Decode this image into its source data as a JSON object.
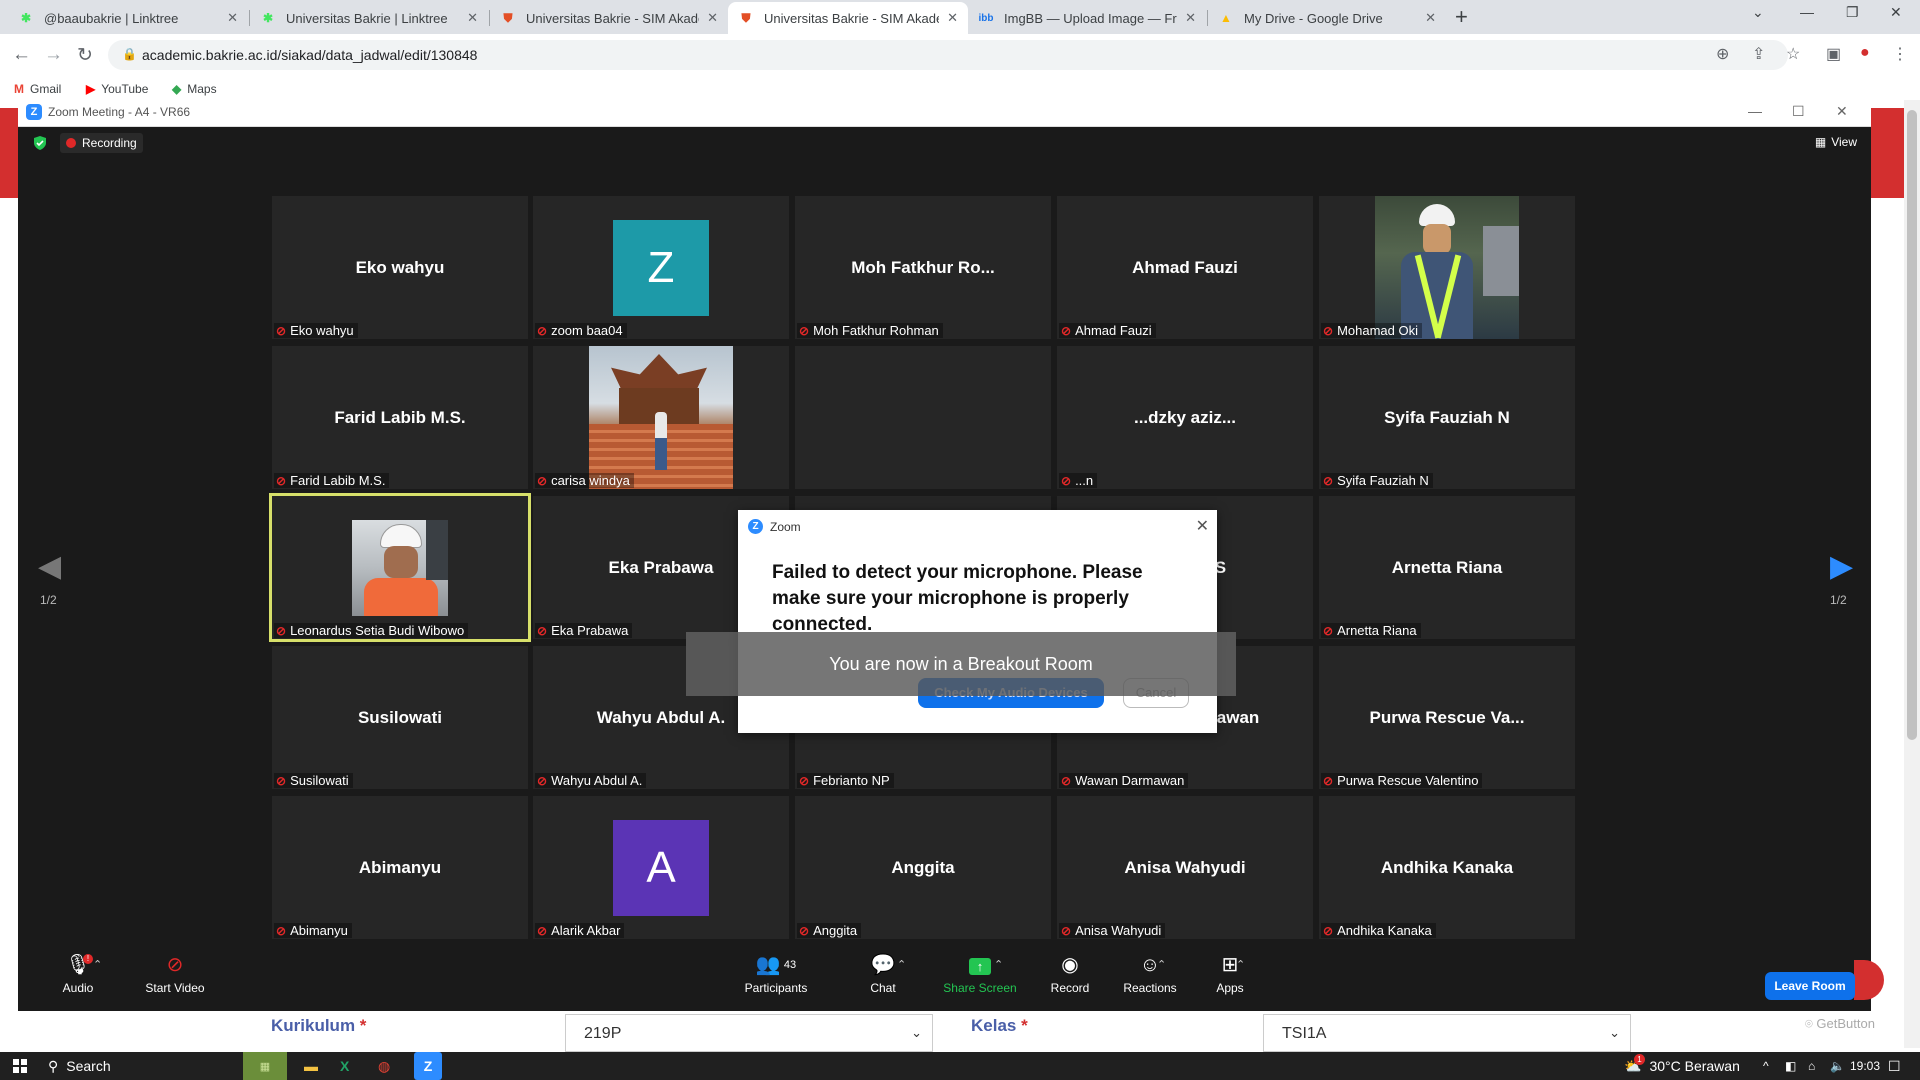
{
  "browser": {
    "tabs": [
      {
        "title": "@baaubakrie | Linktree",
        "icon": "linktree-icon",
        "active": false
      },
      {
        "title": "Universitas Bakrie | Linktree",
        "icon": "linktree-icon",
        "active": false
      },
      {
        "title": "Universitas Bakrie - SIM Akadem",
        "icon": "html5-icon",
        "active": false
      },
      {
        "title": "Universitas Bakrie - SIM Akadem",
        "icon": "html5-icon",
        "active": true
      },
      {
        "title": "ImgBB — Upload Image — Free",
        "icon": "imgbb-icon",
        "active": false
      },
      {
        "title": "My Drive - Google Drive",
        "icon": "drive-icon",
        "active": false
      }
    ],
    "url": "academic.bakrie.ac.id/siakad/data_jadwal/edit/130848",
    "bookmarks": [
      {
        "label": "Gmail"
      },
      {
        "label": "YouTube"
      },
      {
        "label": "Maps"
      }
    ]
  },
  "zoom": {
    "window_title": "Zoom Meeting - A4 - VR66",
    "recording_label": "Recording",
    "view_label": "View",
    "page_indicator_left": "1/2",
    "page_indicator_right": "1/2",
    "tiles": [
      {
        "big": "Eko wahyu",
        "label": "Eko wahyu"
      },
      {
        "big": "",
        "label": "zoom baa04",
        "avatar": "Z",
        "avatar_color": "#1d9aa8"
      },
      {
        "big": "Moh  Fatkhur  Ro...",
        "label": "Moh Fatkhur Rohman"
      },
      {
        "big": "Ahmad Fauzi",
        "label": "Ahmad Fauzi"
      },
      {
        "big": "",
        "label": "Mohamad Oki",
        "photo": "worker"
      },
      {
        "big": "Farid Labib M.S.",
        "label": "Farid Labib M.S."
      },
      {
        "big": "",
        "label": "carisa windya",
        "photo": "pavilion"
      },
      {
        "big": "",
        "label": ""
      },
      {
        "big": "...dzky aziz...",
        "label": "...n"
      },
      {
        "big": "Syifa Fauziah N",
        "label": "Syifa Fauziah N"
      },
      {
        "big": "",
        "label": "Leonardus Setia Budi Wibowo",
        "photo": "helmet",
        "active": true
      },
      {
        "big": "Eka Prabawa",
        "label": "Eka Prabawa"
      },
      {
        "big": "",
        "label": ""
      },
      {
        "big": "...ctus B S",
        "label": ""
      },
      {
        "big": "Arnetta Riana",
        "label": "Arnetta Riana"
      },
      {
        "big": "Susilowati",
        "label": "Susilowati"
      },
      {
        "big": "Wahyu Abdul A.",
        "label": "Wahyu Abdul A."
      },
      {
        "big": "Febrianto NP",
        "label": "Febrianto NP"
      },
      {
        "big": "Wawan Darmawan",
        "label": "Wawan Darmawan"
      },
      {
        "big": "Purwa  Rescue  Va...",
        "label": "Purwa Rescue Valentino"
      },
      {
        "big": "Abimanyu",
        "label": "Abimanyu"
      },
      {
        "big": "",
        "label": "Alarik Akbar",
        "avatar": "A",
        "avatar_color": "#5b34b5"
      },
      {
        "big": "Anggita",
        "label": "Anggita"
      },
      {
        "big": "Anisa Wahyudi",
        "label": "Anisa Wahyudi"
      },
      {
        "big": "Andhika Kanaka",
        "label": "Andhika Kanaka"
      }
    ],
    "dialog": {
      "title": "Zoom",
      "message": "Failed to detect your microphone. Please make sure your microphone is properly connected.",
      "primary_button": "Check My Audio Devices",
      "cancel_button": "Cancel"
    },
    "breakout_notice": "You are now in a Breakout Room",
    "toolbar": {
      "audio": "Audio",
      "start_video": "Start Video",
      "participants": "Participants",
      "participants_count": "43",
      "chat": "Chat",
      "share_screen": "Share Screen",
      "record": "Record",
      "reactions": "Reactions",
      "apps": "Apps",
      "leave_room": "Leave Room"
    }
  },
  "page": {
    "kurikulum_label": "Kurikulum",
    "kurikulum_value": "219P",
    "kelas_label": "Kelas",
    "kelas_value": "TSI1A",
    "required_mark": "*",
    "getbutton": "GetButton"
  },
  "taskbar": {
    "search_label": "Search",
    "weather": "30°C  Berawan",
    "time": "19:03",
    "weather_badge": "1"
  },
  "colors": {
    "zoom_blue": "#0e71eb",
    "brand_red": "#d32f2f",
    "mic_muted": "#e02828",
    "share_green": "#23c552"
  }
}
